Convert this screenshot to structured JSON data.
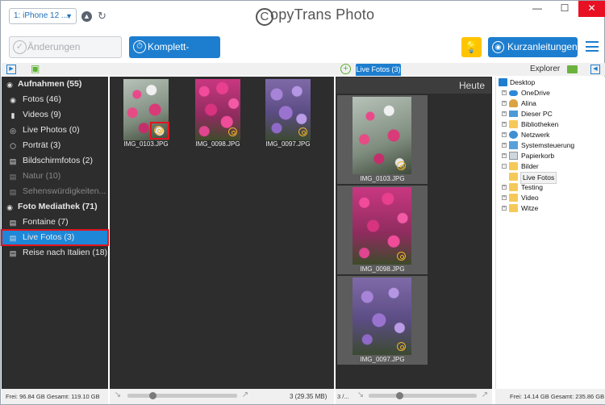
{
  "titlebar": {
    "device_label": "1: iPhone 12 ...",
    "brand": "opyTrans Photo",
    "brand_c": "C",
    "min_glyph": "—",
    "max_glyph": "☐",
    "close_glyph": "✕"
  },
  "toolbar": {
    "save_label": "Änderungen speichern",
    "backup_label": "Komplett-Backup",
    "guides_label": "Kurzanleitungen",
    "tip_icon": "lightbulb-icon"
  },
  "panes": {
    "live_tab_label": "Live Fotos (3)",
    "explorer_label": "Explorer"
  },
  "sidebar": {
    "items": [
      {
        "label": "Aufnahmen (55)",
        "icon": "camera-icon"
      },
      {
        "label": "Fotos (46)",
        "icon": "photo-camera-icon"
      },
      {
        "label": "Videos (9)",
        "icon": "video-icon"
      },
      {
        "label": "Live Photos (0)",
        "icon": "live-photo-icon"
      },
      {
        "label": "Porträt (3)",
        "icon": "portrait-cube-icon"
      },
      {
        "label": "Bildschirmfotos (2)",
        "icon": "album-icon"
      },
      {
        "label": "Natur (10)",
        "icon": "album-icon"
      },
      {
        "label": "Sehenswürdigkeiten...",
        "icon": "album-icon"
      },
      {
        "label": "Foto Mediathek (71)",
        "icon": "camera-icon"
      },
      {
        "label": "Fontaine (7)",
        "icon": "album-icon"
      },
      {
        "label": "Live Fotos (3)",
        "icon": "album-icon"
      },
      {
        "label": "Reise nach Italien (18)",
        "icon": "album-icon"
      }
    ]
  },
  "pc_photos": [
    {
      "name": "IMG_0103.JPG"
    },
    {
      "name": "IMG_0098.JPG"
    },
    {
      "name": "IMG_0097.JPG"
    }
  ],
  "device_photos": {
    "group_label": "Heute",
    "items": [
      {
        "name": "IMG_0103.JPG"
      },
      {
        "name": "IMG_0098.JPG"
      },
      {
        "name": "IMG_0097.JPG"
      }
    ]
  },
  "explorer": {
    "items": [
      {
        "label": "Desktop"
      },
      {
        "label": "OneDrive"
      },
      {
        "label": "Alina"
      },
      {
        "label": "Dieser PC"
      },
      {
        "label": "Bibliotheken"
      },
      {
        "label": "Netzwerk"
      },
      {
        "label": "Systemsteuerung"
      },
      {
        "label": "Papierkorb"
      },
      {
        "label": "Bilder"
      },
      {
        "label": "Live Fotos"
      },
      {
        "label": "Testing"
      },
      {
        "label": "Video"
      },
      {
        "label": "Witze"
      }
    ]
  },
  "status": {
    "left": "Frei: 96.84 GB Gesamt: 119.10 GB",
    "middle": "3 (29.35 MB)",
    "right_pane": "3 /...",
    "right": "Frei: 14.14 GB Gesamt: 235.86 GB"
  },
  "colors": {
    "accent": "#1d7ecf",
    "pane_bg": "#2d2d2d",
    "highlight_red": "#e3141d",
    "green": "#5cb132",
    "tip_yellow": "#ffc400"
  }
}
